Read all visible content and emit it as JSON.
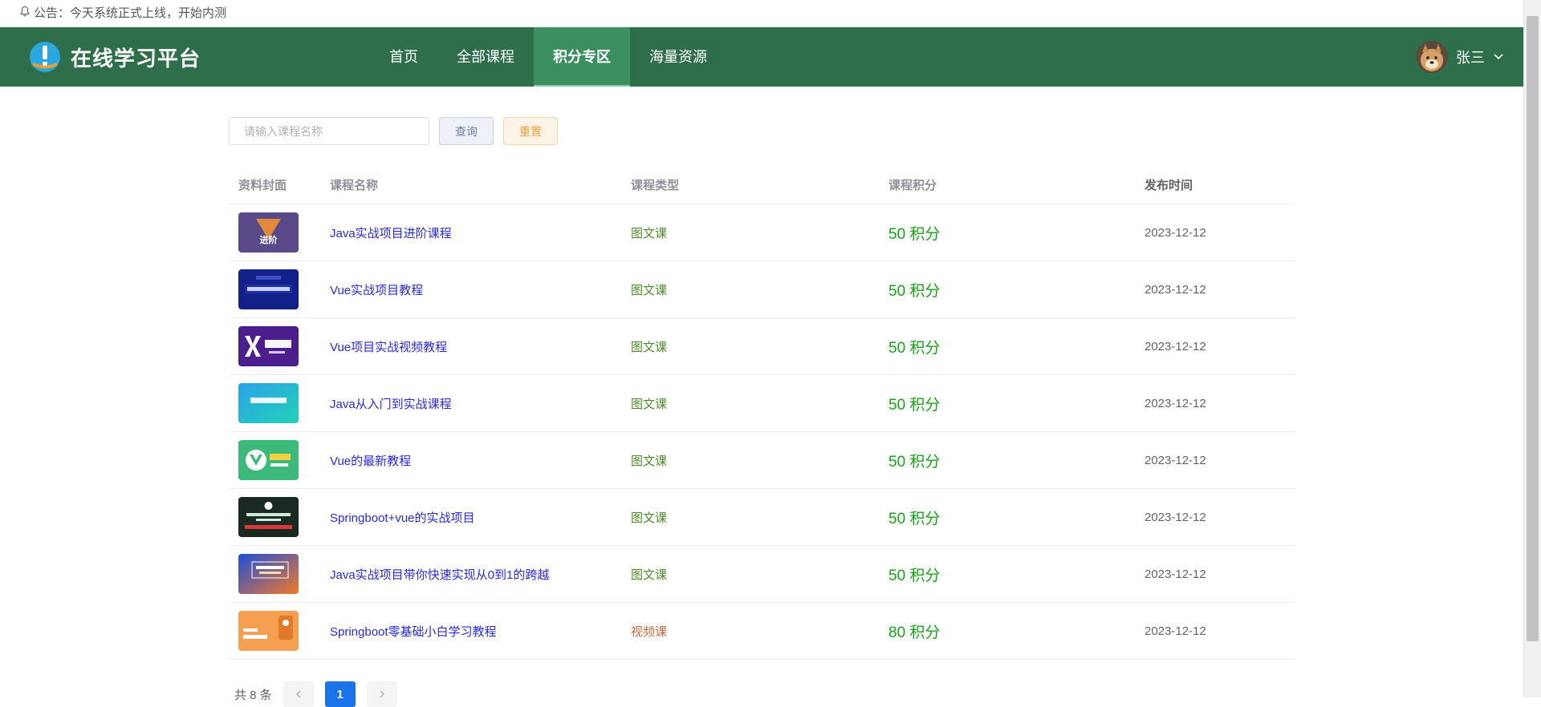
{
  "notice": {
    "icon": "bell-icon",
    "text": "公告：今天系统正式上线，开始内测"
  },
  "header": {
    "logo_icon": "exclamation-badge-icon",
    "title": "在线学习平台",
    "bg_color": "#2e6e4a",
    "active_color": "#3c9060",
    "nav": [
      {
        "label": "首页",
        "active": false
      },
      {
        "label": "全部课程",
        "active": false
      },
      {
        "label": "积分专区",
        "active": true
      },
      {
        "label": "海量资源",
        "active": false
      }
    ],
    "user": {
      "name": "张三",
      "dropdown_icon": "chevron-down-icon"
    }
  },
  "search": {
    "placeholder": "请输入课程名称",
    "value": "",
    "query_label": "查询",
    "reset_label": "重置"
  },
  "table": {
    "headers": {
      "cover": "资料封面",
      "name": "课程名称",
      "type": "课程类型",
      "score": "课程积分",
      "date": "发布时间"
    },
    "rows": [
      {
        "cover": "cover-advanced",
        "name": "Java实战项目进阶课程",
        "type": "图文课",
        "score": "50 积分",
        "date": "2023-12-12"
      },
      {
        "cover": "cover-vue-project",
        "name": "Vue实战项目教程",
        "type": "图文课",
        "score": "50 积分",
        "date": "2023-12-12"
      },
      {
        "cover": "cover-vuejs",
        "name": "Vue项目实战视频教程",
        "type": "图文课",
        "score": "50 积分",
        "date": "2023-12-12"
      },
      {
        "cover": "cover-java-intro",
        "name": "Java从入门到实战课程",
        "type": "图文课",
        "score": "50 积分",
        "date": "2023-12-12"
      },
      {
        "cover": "cover-vue-latest",
        "name": "Vue的最新教程",
        "type": "图文课",
        "score": "50 积分",
        "date": "2023-12-12"
      },
      {
        "cover": "cover-springboot-vue",
        "name": "Springboot+vue的实战项目",
        "type": "图文课",
        "score": "50 积分",
        "date": "2023-12-12"
      },
      {
        "cover": "cover-java-0-1",
        "name": "Java实战项目带你快速实现从0到1的跨越",
        "type": "图文课",
        "score": "50 积分",
        "date": "2023-12-12"
      },
      {
        "cover": "cover-java-zero",
        "name": "Springboot零基础小白学习教程",
        "type": "视频课",
        "score": "80 积分",
        "date": "2023-12-12"
      }
    ]
  },
  "pagination": {
    "total_text": "共 8 条",
    "current_page": "1"
  }
}
